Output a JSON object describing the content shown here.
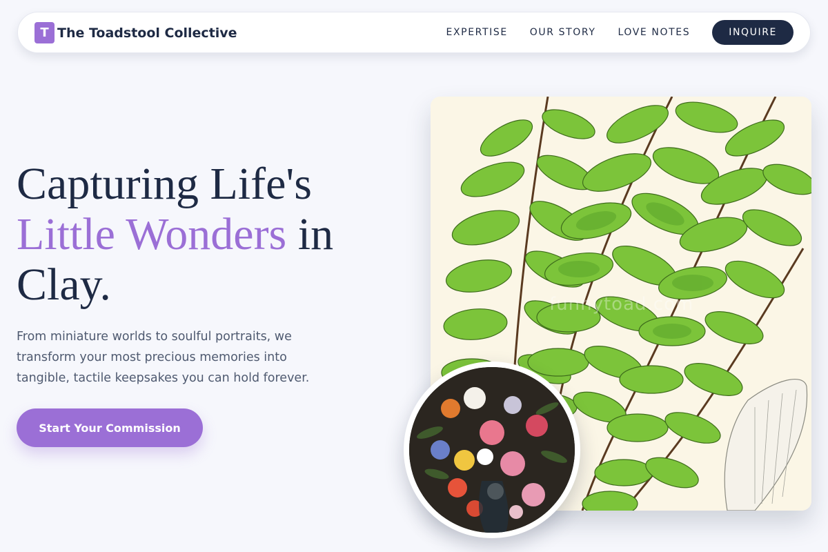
{
  "brand": {
    "icon_letter": "T",
    "name": "The Toadstool Collective"
  },
  "nav": {
    "links": [
      "EXPERTISE",
      "OUR STORY",
      "LOVE NOTES"
    ],
    "cta": "INQUIRE"
  },
  "hero": {
    "title_line1": "Capturing Life's",
    "title_accent": "Little Wonders",
    "title_after_accent": " in",
    "title_line3": "Clay.",
    "description": "From miniature worlds to soulful portraits, we transform your most precious memories into tangible, tactile keepsakes you can hold forever.",
    "cta": "Start Your Commission"
  },
  "images": {
    "main_watermark": "funnytoad.com",
    "main_subject": "botanical-fern-illustration",
    "inset_subject": "floral-still-life-painting"
  },
  "colors": {
    "accent": "#9b6fd6",
    "navy": "#1e2a44",
    "background": "#f6f7fc",
    "text_muted": "#4f5a70"
  }
}
